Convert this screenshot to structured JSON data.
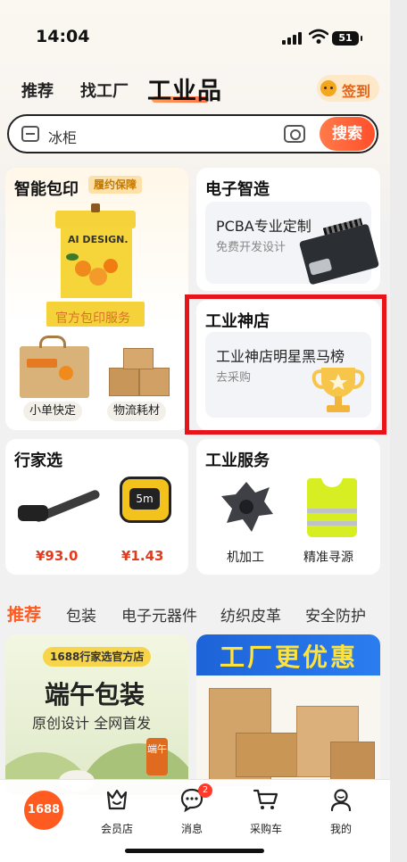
{
  "status": {
    "time": "14:04",
    "battery": "51"
  },
  "topnav": {
    "tabs": [
      "推荐",
      "找工厂"
    ],
    "active": "工业品",
    "signin": "签到"
  },
  "search": {
    "placeholder": "冰柜",
    "button": "搜索"
  },
  "smart_print": {
    "title": "智能包印",
    "tag": "履约保障",
    "link": "官方包印服务",
    "pill1": "小单快定",
    "pill2": "物流耗材",
    "box_text": "AI DESIGN."
  },
  "electronics": {
    "title": "电子智造",
    "headline": "PCBA专业定制",
    "sub": "免费开发设计"
  },
  "industry_shop": {
    "title": "工业神店",
    "headline": "工业神店明星黑马榜",
    "sub": "去采购"
  },
  "expert": {
    "title": "行家选",
    "price1": "¥93.0",
    "price2": "¥1.43",
    "tape_text": "5m"
  },
  "service": {
    "title": "工业服务",
    "item1": "机加工",
    "item2": "精准寻源"
  },
  "categories": {
    "active": "推荐",
    "items": [
      "包装",
      "电子元器件",
      "纺织皮革",
      "安全防护"
    ]
  },
  "promo1": {
    "badge": "1688行家选官方店",
    "title": "端午包装",
    "sub": "原创设计 全网首发",
    "stamp": "端午"
  },
  "promo2": {
    "title": "工厂更优惠"
  },
  "bottomnav": {
    "logo": "1688",
    "items": [
      "会员店",
      "消息",
      "采购车",
      "我的"
    ],
    "badge": "2"
  },
  "colors": {
    "accent": "#ff5a1f",
    "highlight": "#e8141a"
  }
}
